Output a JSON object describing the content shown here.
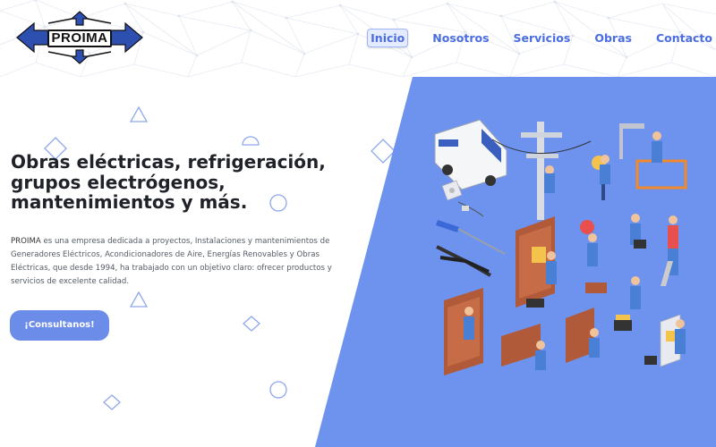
{
  "logo": {
    "text": "PROIMA"
  },
  "nav": {
    "items": [
      {
        "label": "Inicio"
      },
      {
        "label": "Nosotros"
      },
      {
        "label": "Servicios"
      },
      {
        "label": "Obras"
      },
      {
        "label": "Contacto"
      }
    ]
  },
  "hero": {
    "title_lines": [
      "Obras eléctricas, refrigeración,",
      "grupos electrógenos,",
      "mantenimientos y más."
    ],
    "description_brand": "PROIMA",
    "description": " es una empresa dedicada a proyectos, Instalaciones y mantenimientos de Generadores Eléctricos, Acondicionadores de Aire, Energías Renovables y Obras Eléctricas, que desde 1994, ha trabajado con un objetivo claro: ofrecer productos y servicios de excelente calidad.",
    "cta_label": "¡Consultanos!"
  },
  "colors": {
    "accent": "#6b8ce8",
    "panel": "#6d93ee",
    "nav_text": "#4a6ee0",
    "title": "#1f2228"
  }
}
